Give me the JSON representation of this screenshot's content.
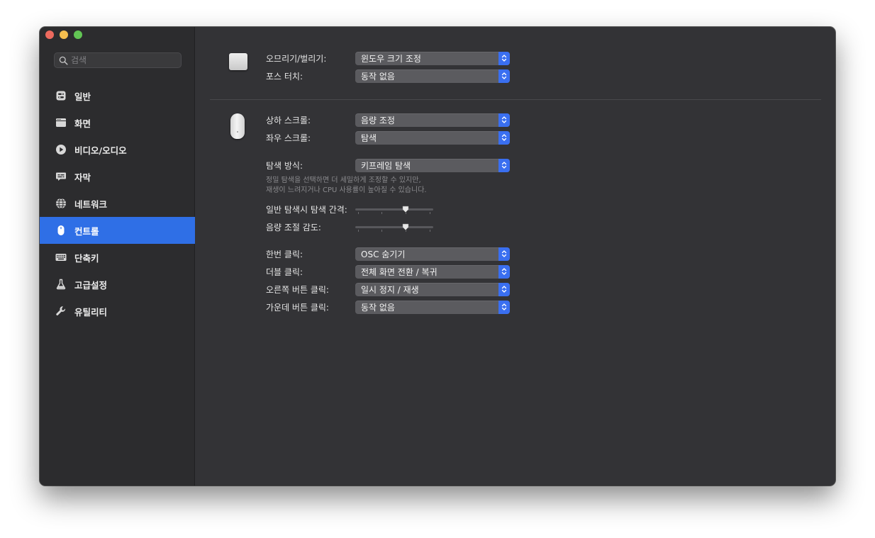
{
  "search": {
    "placeholder": "검색"
  },
  "sidebar": {
    "items": [
      {
        "label": "일반",
        "icon": "general-icon",
        "active": false
      },
      {
        "label": "화면",
        "icon": "display-icon",
        "active": false
      },
      {
        "label": "비디오/오디오",
        "icon": "play-icon",
        "active": false
      },
      {
        "label": "자막",
        "icon": "subtitles-icon",
        "active": false
      },
      {
        "label": "네트워크",
        "icon": "globe-icon",
        "active": false
      },
      {
        "label": "컨트롤",
        "icon": "mouse-icon",
        "active": true
      },
      {
        "label": "단축키",
        "icon": "keyboard-icon",
        "active": false
      },
      {
        "label": "고급설정",
        "icon": "flask-icon",
        "active": false
      },
      {
        "label": "유틸리티",
        "icon": "wrench-icon",
        "active": false
      }
    ]
  },
  "trackpad": {
    "pinch_label": "오므리기/벌리기:",
    "pinch_value": "윈도우 크기 조정",
    "force_label": "포스 터치:",
    "force_value": "동작 없음"
  },
  "mouse": {
    "vscroll_label": "상하 스크롤:",
    "vscroll_value": "음량 조정",
    "hscroll_label": "좌우 스크롤:",
    "hscroll_value": "탐색",
    "seek_label": "탐색 방식:",
    "seek_value": "키프레임 탐색",
    "hint_line1": "정밀 탐색을 선택하면 더 세밀하게 조정할 수 있지만,",
    "hint_line2": "재생이 느려지거나 CPU 사용률이 높아질 수 있습니다.",
    "seek_interval_label": "일반 탐색시 탐색 간격:",
    "seek_interval_level": 0.66,
    "volume_sens_label": "음량 조절 감도:",
    "volume_sens_level": 0.66,
    "single_click_label": "한번 클릭:",
    "single_click_value": "OSC 숨기기",
    "double_click_label": "더블 클릭:",
    "double_click_value": "전체 화면 전환 / 복귀",
    "right_click_label": "오른쪽 버튼 클릭:",
    "right_click_value": "일시 정지 / 재생",
    "middle_click_label": "가운데 버튼 클릭:",
    "middle_click_value": "동작 없음"
  },
  "colors": {
    "accent": "#2f6fe6",
    "select_arrow": "#3a6ff0",
    "window_bg": "#333336",
    "sidebar_bg": "#2c2c2e"
  }
}
